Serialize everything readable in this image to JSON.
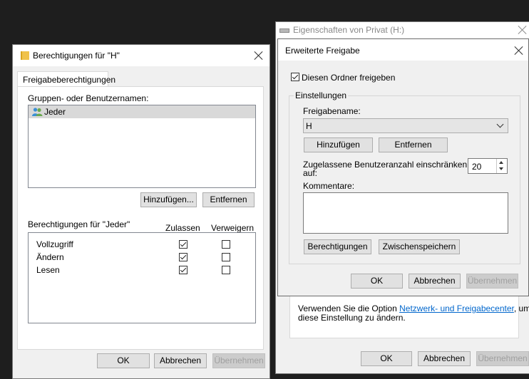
{
  "left_dialog": {
    "title": "Berechtigungen für \"H\"",
    "tab": "Freigabeberechtigungen",
    "group_label": "Gruppen- oder Benutzernamen:",
    "users": [
      {
        "name": "Jeder",
        "icon": "users-icon"
      }
    ],
    "add_button": "Hinzufügen...",
    "remove_button": "Entfernen",
    "permissions_title": "Berechtigungen für \"Jeder\"",
    "col_allow": "Zulassen",
    "col_deny": "Verweigern",
    "permissions": [
      {
        "name": "Vollzugriff",
        "allow": true,
        "deny": false
      },
      {
        "name": "Ändern",
        "allow": true,
        "deny": false
      },
      {
        "name": "Lesen",
        "allow": true,
        "deny": false
      }
    ],
    "ok": "OK",
    "cancel": "Abbrechen",
    "apply": "Übernehmen"
  },
  "back_window": {
    "title": "Eigenschaften von Privat (H:)",
    "info_text_before": "Verwenden Sie die Option ",
    "info_link": "Netzwerk- und Freigabecenter",
    "info_text_after": ", um",
    "info_line2": "diese Einstellung zu ändern.",
    "ok": "OK",
    "cancel": "Abbrechen",
    "apply": "Übernehmen"
  },
  "advanced_dialog": {
    "title": "Erweiterte Freigabe",
    "share_checkbox_label": "Diesen Ordner freigeben",
    "share_checked": true,
    "settings_group": "Einstellungen",
    "share_name_label": "Freigabename:",
    "share_name_value": "H",
    "add_button": "Hinzufügen",
    "remove_button": "Entfernen",
    "limit_label_line1": "Zugelassene Benutzeranzahl einschränken",
    "limit_label_line2": "auf:",
    "limit_value": "20",
    "comments_label": "Kommentare:",
    "permissions_button": "Berechtigungen",
    "caching_button": "Zwischenspeichern",
    "ok": "OK",
    "cancel": "Abbrechen",
    "apply": "Übernehmen"
  },
  "colors": {
    "desktop": "#1e1e1e",
    "dialog": "#f0f0f0",
    "link": "#0066cc",
    "selection": "#d9d9d9"
  }
}
